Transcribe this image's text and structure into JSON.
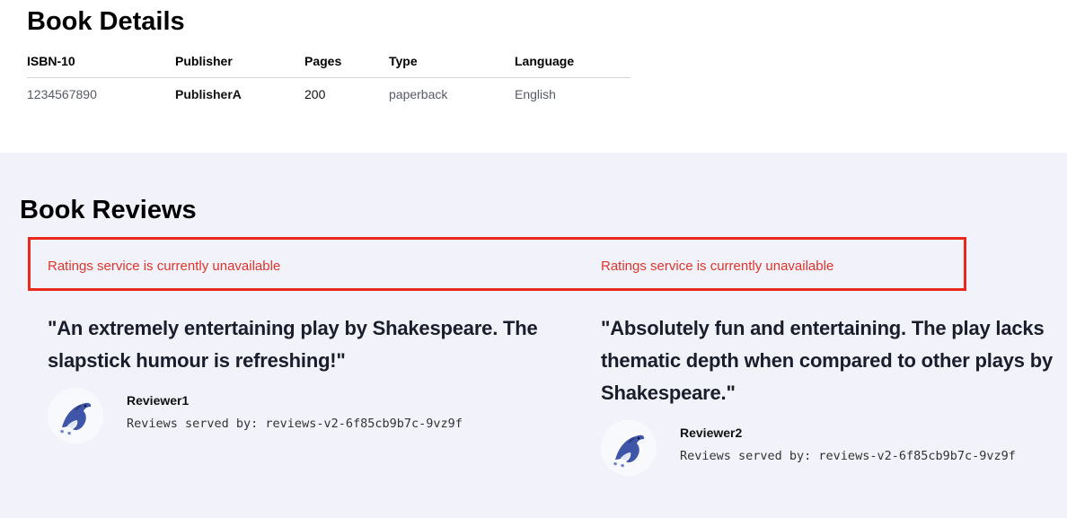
{
  "details": {
    "title": "Book Details",
    "columns": [
      "ISBN-10",
      "Publisher",
      "Pages",
      "Type",
      "Language"
    ],
    "row": {
      "isbn10": "1234567890",
      "publisher": "PublisherA",
      "pages": "200",
      "type": "paperback",
      "language": "English"
    }
  },
  "reviews": {
    "title": "Book Reviews",
    "ratings_error": "Ratings service is currently unavailable",
    "items": [
      {
        "text": "\"An extremely entertaining play by Shakespeare. The slapstick humour is refreshing!\"",
        "reviewer": "Reviewer1",
        "served_by": "Reviews served by: reviews-v2-6f85cb9b7c-9vz9f",
        "avatar_icon": "dolphin-avatar-icon",
        "rating_status": "Ratings service is currently unavailable"
      },
      {
        "text": "\"Absolutely fun and entertaining. The play lacks thematic depth when compared to other plays by Shakespeare.\"",
        "reviewer": "Reviewer2",
        "served_by": "Reviews served by: reviews-v2-6f85cb9b7c-9vz9f",
        "avatar_icon": "dolphin-avatar-icon",
        "rating_status": "Ratings service is currently unavailable"
      }
    ]
  },
  "colors": {
    "error": "#e0342b",
    "error_border": "#e8291c",
    "reviews_background": "#f2f3fa"
  }
}
